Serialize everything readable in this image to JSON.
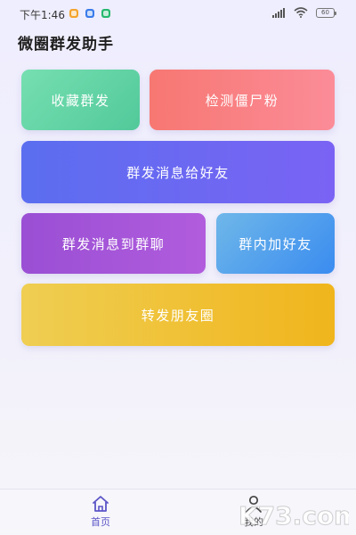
{
  "status_bar": {
    "time": "下午1:46",
    "battery": "60"
  },
  "app": {
    "title": "微圈群发助手"
  },
  "actions": {
    "collect_broadcast": "收藏群发",
    "detect_zombie": "检测僵尸粉",
    "broadcast_friends": "群发消息给好友",
    "broadcast_groups": "群发消息到群聊",
    "add_group_friends": "群内加好友",
    "forward_moments": "转发朋友圈"
  },
  "bottom_nav": {
    "home_label": "首页",
    "mine_label": "我的"
  },
  "watermark": {
    "text": "K73.com"
  },
  "colors": {
    "collect": "#5fd3a4",
    "detect": "#f98183",
    "friends": "#6a69f2",
    "group": "#a655d8",
    "add": "#4f9eee",
    "moments": "#f0c133",
    "nav_active": "#5b55c7"
  },
  "icons": {
    "home": "home-icon",
    "mine": "user-icon",
    "signal": "signal-icon",
    "wifi": "wifi-icon",
    "battery": "battery-icon"
  }
}
